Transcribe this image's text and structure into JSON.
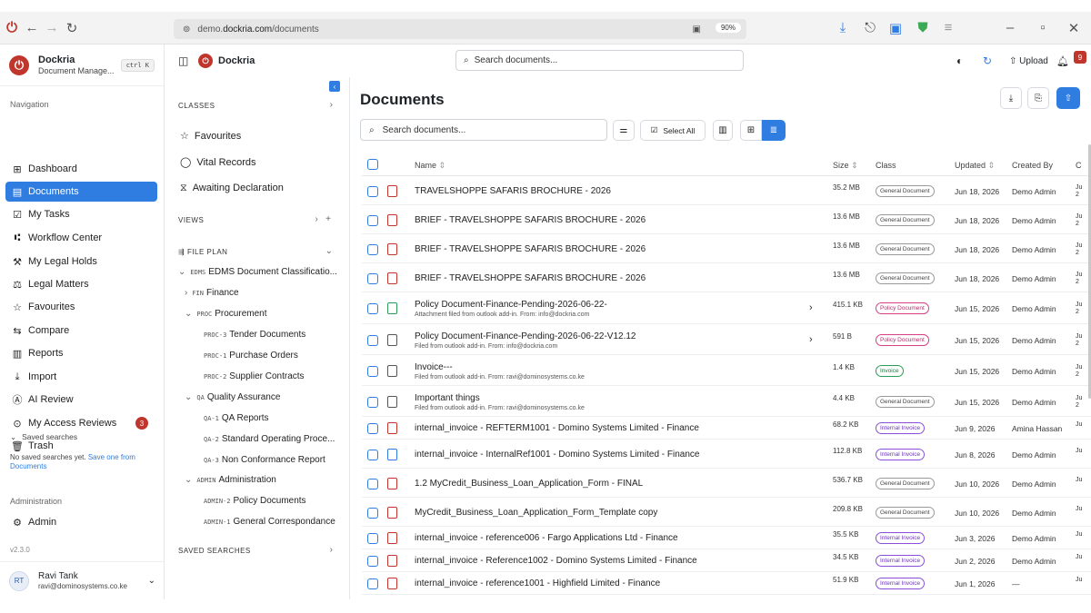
{
  "browser": {
    "url_prefix": "demo.",
    "url_host": "dockria.com",
    "url_path": "/documents",
    "zoom": "90%"
  },
  "sidebar": {
    "brand": "Dockria",
    "brand_sub": "Document Manage...",
    "shortcut": "ctrl K",
    "nav_label": "Navigation",
    "items": [
      {
        "label": "Dashboard",
        "icon": "⊞"
      },
      {
        "label": "Documents",
        "icon": "▤"
      },
      {
        "label": "My Tasks",
        "icon": "☑"
      },
      {
        "label": "Workflow Center",
        "icon": "⑆"
      },
      {
        "label": "My Legal Holds",
        "icon": "⚒"
      },
      {
        "label": "Legal Matters",
        "icon": "⚖"
      },
      {
        "label": "Favourites",
        "icon": "☆"
      },
      {
        "label": "Compare",
        "icon": "⇆"
      },
      {
        "label": "Reports",
        "icon": "▥"
      },
      {
        "label": "Import",
        "icon": "⤓"
      },
      {
        "label": "AI Review",
        "icon": "Ⓐ"
      },
      {
        "label": "My Access Reviews",
        "icon": "⊙",
        "badge": "3"
      },
      {
        "label": "Trash",
        "icon": "🗑"
      }
    ],
    "saved_label": "Saved searches",
    "saved_empty": "No saved searches yet.",
    "saved_link": "Save one from",
    "saved_link2": "Documents",
    "admin_label": "Administration",
    "admin_item": "Admin",
    "version": "v2.3.0",
    "user": {
      "initials": "RT",
      "name": "Ravi Tank",
      "email": "ravi@dominosystems.co.ke"
    }
  },
  "classpanel": {
    "title": "Dockria",
    "classes": "CLASSES",
    "items": [
      "Favourites",
      "Vital Records",
      "Awaiting Declaration"
    ],
    "views": "VIEWS",
    "fileplan": "FILE PLAN",
    "tree": [
      {
        "code": "EDMS",
        "label": "EDMS Document Classificatio..."
      },
      {
        "code": "FIN",
        "label": "Finance"
      },
      {
        "code": "PROC",
        "label": "Procurement"
      },
      {
        "code": "PROC-3",
        "label": "Tender Documents"
      },
      {
        "code": "PROC-1",
        "label": "Purchase Orders"
      },
      {
        "code": "PROC-2",
        "label": "Supplier Contracts"
      },
      {
        "code": "QA",
        "label": "Quality Assurance"
      },
      {
        "code": "QA-1",
        "label": "QA Reports"
      },
      {
        "code": "QA-2",
        "label": "Standard Operating Proce..."
      },
      {
        "code": "QA-3",
        "label": "Non Conformance Report"
      },
      {
        "code": "ADMIN",
        "label": "Administration"
      },
      {
        "code": "ADMIN-2",
        "label": "Policy Documents"
      },
      {
        "code": "ADMIN-1",
        "label": "General Correspondance"
      }
    ],
    "saved": "SAVED SEARCHES"
  },
  "topbar": {
    "search_placeholder": "Search documents...",
    "upload": "Upload",
    "notif": "9"
  },
  "main": {
    "title": "Documents",
    "search_placeholder": "Search documents...",
    "select_all": "Select All",
    "columns": {
      "name": "Name",
      "size": "Size",
      "class": "Class",
      "updated": "Updated",
      "created_by": "Created By",
      "c": "C"
    },
    "rows": [
      {
        "name": "TRAVELSHOPPE SAFARIS BROCHURE - 2026",
        "sub": "",
        "size": "35.2 MB",
        "class": "General Document",
        "updated": "Jun 18, 2026",
        "by": "Demo Admin",
        "icon": "red",
        "cut": "Ju 2"
      },
      {
        "name": "BRIEF - TRAVELSHOPPE SAFARIS BROCHURE - 2026",
        "sub": "",
        "size": "13.6 MB",
        "class": "General Document",
        "updated": "Jun 18, 2026",
        "by": "Demo Admin",
        "icon": "red",
        "cut": "Ju 2"
      },
      {
        "name": "BRIEF - TRAVELSHOPPE SAFARIS BROCHURE - 2026",
        "sub": "",
        "size": "13.6 MB",
        "class": "General Document",
        "updated": "Jun 18, 2026",
        "by": "Demo Admin",
        "icon": "red",
        "cut": "Ju 2"
      },
      {
        "name": "BRIEF - TRAVELSHOPPE SAFARIS BROCHURE - 2026",
        "sub": "",
        "size": "13.6 MB",
        "class": "General Document",
        "updated": "Jun 18, 2026",
        "by": "Demo Admin",
        "icon": "red",
        "cut": "Ju 2"
      },
      {
        "name": "Policy Document-Finance-Pending-2026-06-22-",
        "sub": "Attachment filed from outlook add-in. From: info@dockria.com",
        "size": "415.1 KB",
        "class": "Policy Document",
        "updated": "Jun 15, 2026",
        "by": "Demo Admin",
        "icon": "green",
        "cut": "Ju 2",
        "chev": true
      },
      {
        "name": "Policy Document-Finance-Pending-2026-06-22-V12.12",
        "sub": "Filed from outlook add-in. From: info@dockria.com",
        "size": "591 B",
        "class": "Policy Document",
        "updated": "Jun 15, 2026",
        "by": "Demo Admin",
        "icon": "gray",
        "cut": "Ju 2",
        "chev": true
      },
      {
        "name": "Invoice---",
        "sub": "Filed from outlook add-in. From: ravi@dominosystems.co.ke",
        "size": "1.4 KB",
        "class": "Invoice",
        "updated": "Jun 15, 2026",
        "by": "Demo Admin",
        "icon": "gray",
        "cut": "Ju 2"
      },
      {
        "name": "Important things",
        "sub": "Filed from outlook add-in. From: ravi@dominosystems.co.ke",
        "size": "4.4 KB",
        "class": "General Document",
        "updated": "Jun 15, 2026",
        "by": "Demo Admin",
        "icon": "gray",
        "cut": "Ju 2"
      },
      {
        "name": "internal_invoice - REFTERM1001 - Domino Systems Limited - Finance",
        "sub": "",
        "size": "68.2 KB",
        "class": "Internal Invoice",
        "updated": "Jun 9, 2026",
        "by": "Amina Hassan",
        "icon": "red",
        "cut": "Ju"
      },
      {
        "name": "internal_invoice - InternalRef1001 - Domino Systems Limited - Finance",
        "sub": "",
        "size": "112.8 KB",
        "class": "Internal Invoice",
        "updated": "Jun 8, 2026",
        "by": "Demo Admin",
        "icon": "blue",
        "cut": "Ju"
      },
      {
        "name": "1.2 MyCredit_Business_Loan_Application_Form - FINAL",
        "sub": "",
        "size": "536.7 KB",
        "class": "General Document",
        "updated": "Jun 10, 2026",
        "by": "Demo Admin",
        "icon": "red",
        "cut": "Ju"
      },
      {
        "name": "MyCredit_Business_Loan_Application_Form_Template copy",
        "sub": "",
        "size": "209.8 KB",
        "class": "General Document",
        "updated": "Jun 10, 2026",
        "by": "Demo Admin",
        "icon": "red",
        "cut": "Ju"
      },
      {
        "name": "internal_invoice - reference006 - Fargo Applications Ltd - Finance",
        "sub": "",
        "size": "35.5 KB",
        "class": "Internal Invoice",
        "updated": "Jun 3, 2026",
        "by": "Demo Admin",
        "icon": "red",
        "cut": "Ju"
      },
      {
        "name": "internal_invoice - Reference1002 - Domino Systems Limited - Finance",
        "sub": "",
        "size": "34.5 KB",
        "class": "Internal Invoice",
        "updated": "Jun 2, 2026",
        "by": "Demo Admin",
        "icon": "red",
        "cut": "Ju"
      },
      {
        "name": "internal_invoice - reference1001 - Highfield Limited - Finance",
        "sub": "",
        "size": "51.9 KB",
        "class": "Internal Invoice",
        "updated": "Jun 1, 2026",
        "by": "—",
        "icon": "red",
        "cut": "Ju"
      }
    ]
  }
}
